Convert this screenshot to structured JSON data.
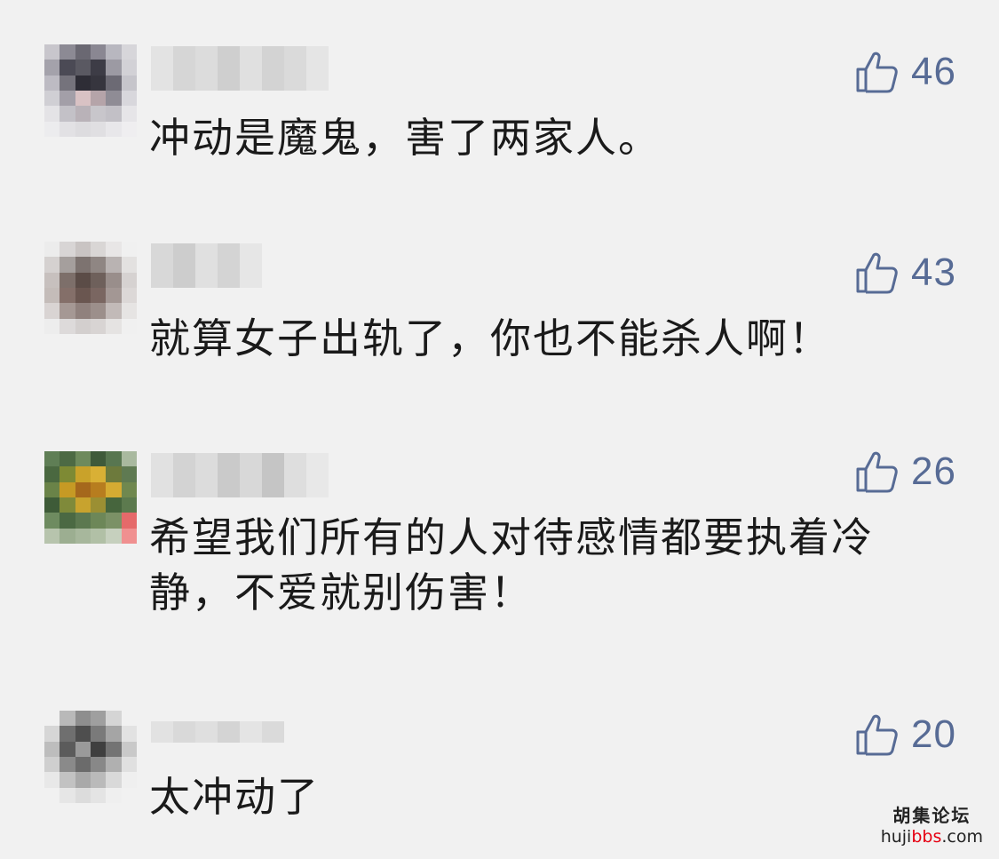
{
  "comments": [
    {
      "avatar_colors": [
        "#c8c6cc",
        "#8c8a94",
        "#6a6872",
        "#8a8792",
        "#b8b7bf",
        "#d7d6da",
        "#a4a2ab",
        "#4b4a55",
        "#5a5962",
        "#3d3c46",
        "#9c9aa3",
        "#d2d1d6",
        "#bdbbc3",
        "#75737c",
        "#2e2d36",
        "#36353e",
        "#6c6a74",
        "#c6c5cb",
        "#d0cfd4",
        "#a39fa8",
        "#d9c2c4",
        "#b5a4a9",
        "#8f8c95",
        "#d8d7dc",
        "#e4e3e6",
        "#c3c1c7",
        "#b9b2b8",
        "#c8c6cb",
        "#c2c0c6",
        "#e6e5e8",
        "#ececee",
        "#e2e1e4",
        "#dddcdf",
        "#e0dfe2",
        "#e8e7ea",
        "#efeef0"
      ],
      "nick_colors": [
        "#e3e3e3",
        "#d6d6d6",
        "#dcdcdc",
        "#cfcfcf",
        "#e0e0e0",
        "#d3d3d3",
        "#dadada",
        "#e5e5e5"
      ],
      "likes": "46",
      "text": "冲动是魔鬼，害了两家人。"
    },
    {
      "avatar_colors": [
        "#ececec",
        "#d8d5d5",
        "#c9c4c3",
        "#d9d6d5",
        "#e8e6e6",
        "#f0f0f0",
        "#d5d1d0",
        "#a59f9d",
        "#7d7370",
        "#8f8683",
        "#b9b3b2",
        "#e3e1e0",
        "#c7c0be",
        "#7d6f6a",
        "#5b4c47",
        "#6e605b",
        "#998e8b",
        "#d6d2d1",
        "#c4bcb9",
        "#846f69",
        "#6a5650",
        "#7a6661",
        "#a39794",
        "#dcd8d7",
        "#d9d4d3",
        "#a59894",
        "#90817d",
        "#9c8f8b",
        "#c2bab8",
        "#e6e4e3",
        "#ededed",
        "#dddada",
        "#d3cfce",
        "#d8d4d3",
        "#e5e3e2",
        "#f0f0f0"
      ],
      "nick_colors": [
        "#d8d8d8",
        "#cdcdcd",
        "#e0e0e0",
        "#d4d4d4",
        "#e6e6e6"
      ],
      "likes": "43",
      "text": "就算女子出轨了，你也不能杀人啊！"
    },
    {
      "avatar_colors": [
        "#5f7e55",
        "#4d6a44",
        "#6e8a5c",
        "#3f5a3a",
        "#587650",
        "#a9b99f",
        "#4a6840",
        "#7e8a34",
        "#c9a22a",
        "#d9b035",
        "#6d7a3c",
        "#5f7a52",
        "#6a8348",
        "#c69a24",
        "#a5681c",
        "#b77d1f",
        "#d5ab32",
        "#70884f",
        "#3e5b38",
        "#7f8a3a",
        "#c8a32e",
        "#9b8f33",
        "#46653d",
        "#5c7a4e",
        "#6e8b60",
        "#4b6943",
        "#5c7850",
        "#6d8758",
        "#7b9166",
        "#e56a6a",
        "#b7c4ad",
        "#9cae91",
        "#a7b79c",
        "#b1c0a6",
        "#c6d0be",
        "#f09090"
      ],
      "nick_colors": [
        "#e1e1e1",
        "#d3d3d3",
        "#dcdcdc",
        "#cacaca",
        "#d8d8d8",
        "#c5c5c5",
        "#dedede",
        "#e8e8e8"
      ],
      "likes": "26",
      "text": "希望我们所有的人对待感情都要执着冷静，不爱就别伤害！"
    },
    {
      "avatar_colors": [
        "#f1f1f1",
        "#b9b9b9",
        "#8e8e8e",
        "#9f9f9f",
        "#d5d5d5",
        "#f1f1f1",
        "#d6d6d6",
        "#6f6f6f",
        "#4e4e4e",
        "#7a7a7a",
        "#a5a5a5",
        "#e2e2e2",
        "#bdbdbd",
        "#5b5b5b",
        "#9a9a9a",
        "#3f3f3f",
        "#737373",
        "#c9c9c9",
        "#cfcfcf",
        "#8a8a8a",
        "#6b6b6b",
        "#888888",
        "#b0b0b0",
        "#e0e0e0",
        "#e8e8e8",
        "#c2c2c2",
        "#a9a9a9",
        "#bababa",
        "#d9d9d9",
        "#efefef",
        "#f1f1f1",
        "#e6e6e6",
        "#dcdcdc",
        "#e4e4e4",
        "#efefef",
        "#f1f1f1"
      ],
      "nick_colors": [
        "#e2e2e2",
        "#d9d9d9",
        "#dfdfdf",
        "#d4d4d4",
        "#e4e4e4",
        "#dadada"
      ],
      "likes": "20",
      "text": "太冲动了"
    }
  ],
  "watermark": {
    "cn": "胡集论坛",
    "url_prefix": "huji",
    "url_red": "bbs",
    "url_suffix": ".com"
  },
  "colors": {
    "link": "#576b95",
    "text": "#1a1a1a",
    "background": "#f1f1f1"
  }
}
